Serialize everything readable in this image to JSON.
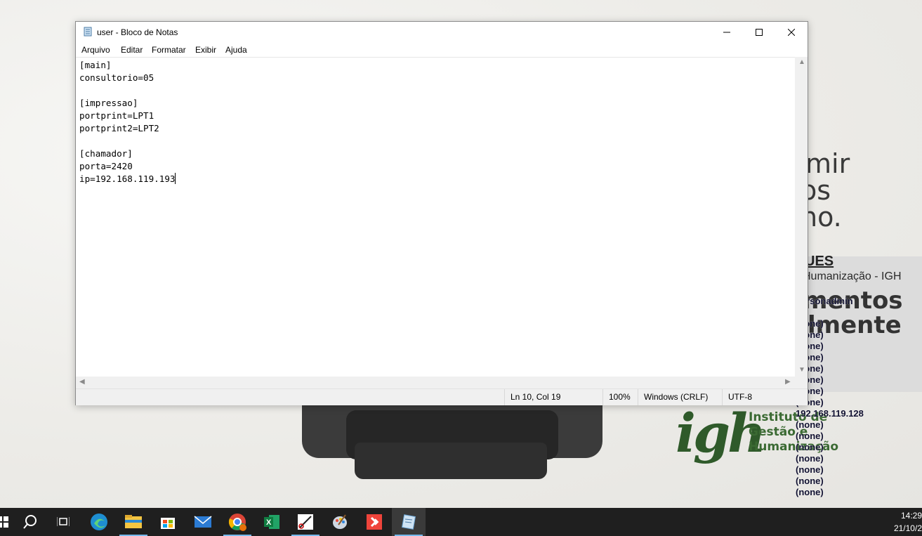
{
  "desktop": {
    "bg_text": {
      "line1": "mir",
      "line2": "os",
      "line3": "no.",
      "heading1": "mentos",
      "heading2": "lmente",
      "bold_label": "UES",
      "org_name": "Humanização - IGH"
    },
    "overlay_list": [
      "personadmin",
      "-11",
      "(none)",
      "(none)",
      "(none)",
      "(none)",
      "(none)",
      "(none)",
      "(none)",
      "(none)",
      "192.168.119.128",
      "(none)",
      "(none)",
      "(none)",
      "(none)",
      "(none)",
      "(none)",
      "(none)"
    ],
    "logo": {
      "mark": "igh",
      "line1": "Instituto de",
      "line2": "Gestão e",
      "line3": "Humanização"
    }
  },
  "notepad": {
    "title": "user - Bloco de Notas",
    "menu": [
      "Arquivo",
      "Editar",
      "Formatar",
      "Exibir",
      "Ajuda"
    ],
    "lines": [
      "[main]",
      "consultorio=05",
      "",
      "[impressao]",
      "portprint=LPT1",
      "portprint2=LPT2",
      "",
      "[chamador]",
      "porta=2420",
      "ip=192.168.119.193"
    ],
    "status": {
      "position": "Ln 10, Col 19",
      "zoom": "100%",
      "line_ending": "Windows (CRLF)",
      "encoding": "UTF-8"
    }
  },
  "taskbar": {
    "icons": [
      "start-icon",
      "search-icon",
      "task-view-icon",
      "edge-icon",
      "file-explorer-icon",
      "store-icon",
      "mail-icon",
      "chrome-icon",
      "excel-icon",
      "snipping-tool-icon",
      "paint-icon",
      "anydesk-icon",
      "notepad-icon"
    ],
    "active": "notepad-icon",
    "time": "14:29",
    "date": "21/10/2"
  },
  "colors": {
    "taskbar": "#1f1f1f",
    "accent": "#76b9ed",
    "logo_green": "#2f5a2a"
  }
}
